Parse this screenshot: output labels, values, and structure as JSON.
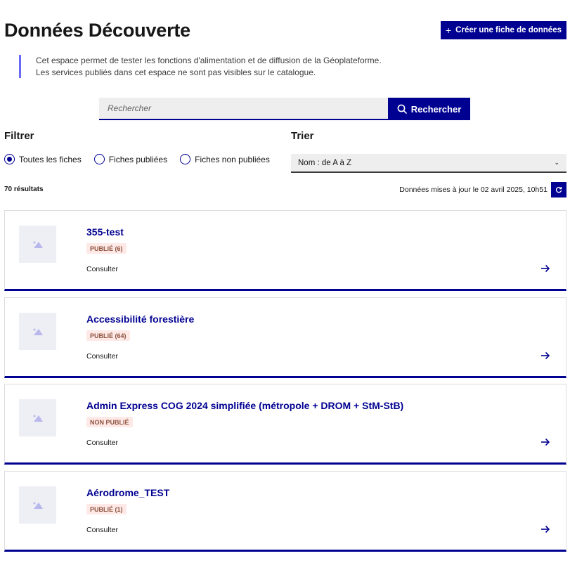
{
  "header": {
    "title": "Données Découverte",
    "create_button": "Créer une fiche de données"
  },
  "callout": {
    "line1": "Cet espace permet de tester les fonctions d'alimentation et de diffusion de la Géoplateforme.",
    "line2": "Les services publiés dans cet espace ne sont pas visibles sur le catalogue."
  },
  "search": {
    "placeholder": "Rechercher",
    "button": "Rechercher"
  },
  "filter": {
    "title": "Filtrer",
    "options": [
      {
        "label": "Toutes les fiches",
        "checked": true
      },
      {
        "label": "Fiches publiées",
        "checked": false
      },
      {
        "label": "Fiches non publiées",
        "checked": false
      }
    ]
  },
  "sort": {
    "title": "Trier",
    "selected": "Nom : de A à Z"
  },
  "results": {
    "count": "70 résultats",
    "updated": "Données mises à jour le 02 avril 2025, 10h51"
  },
  "cards": [
    {
      "title": "355-test",
      "badge": "PUBLIÉ (6)",
      "action": "Consulter"
    },
    {
      "title": "Accessibilité forestière",
      "badge": "PUBLIÉ (64)",
      "action": "Consulter"
    },
    {
      "title": "Admin Express COG 2024 simplifiée (métropole + DROM + StM-StB)",
      "badge": "NON PUBLIÉ",
      "action": "Consulter"
    },
    {
      "title": "Aérodrome_TEST",
      "badge": "PUBLIÉ (1)",
      "action": "Consulter"
    }
  ],
  "colors": {
    "primary": "#000091",
    "badge_bg": "#fee9e7",
    "badge_text": "#8d533e",
    "callout_border": "#6a6af4"
  }
}
